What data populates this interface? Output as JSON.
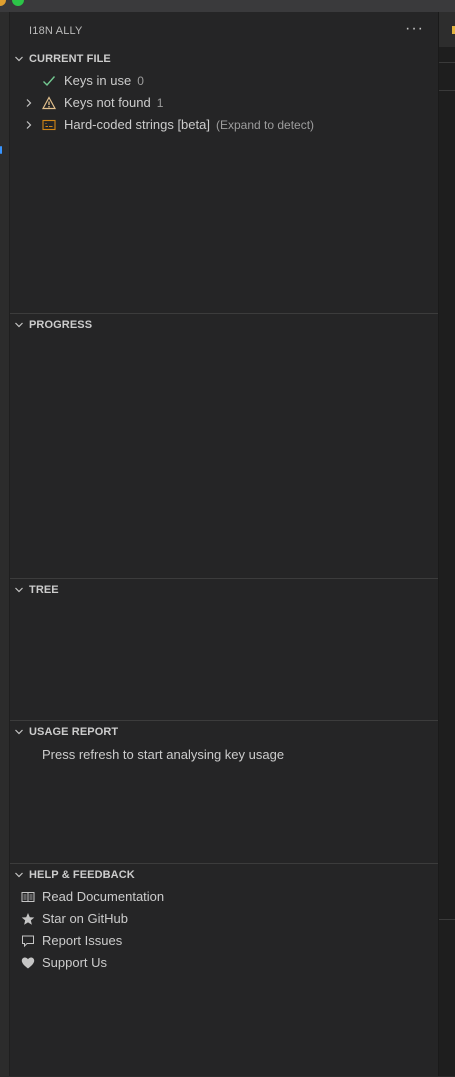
{
  "panel_title": "I18N ALLY",
  "more_actions_label": "···",
  "sections": {
    "current_file": {
      "title": "CURRENT FILE",
      "items": [
        {
          "label": "Keys in use",
          "count": "0",
          "icon": "check-icon"
        },
        {
          "label": "Keys not found",
          "count": "1",
          "icon": "warning-icon"
        },
        {
          "label": "Hard-coded strings [beta]",
          "desc": "(Expand to detect)",
          "icon": "string-icon"
        }
      ]
    },
    "progress": {
      "title": "PROGRESS"
    },
    "tree": {
      "title": "TREE"
    },
    "usage_report": {
      "title": "USAGE REPORT",
      "message": "Press refresh to start analysing key usage"
    },
    "help_feedback": {
      "title": "HELP & FEEDBACK",
      "items": [
        {
          "label": "Read Documentation",
          "icon": "book-icon"
        },
        {
          "label": "Star on GitHub",
          "icon": "star-icon"
        },
        {
          "label": "Report Issues",
          "icon": "comment-icon"
        },
        {
          "label": "Support Us",
          "icon": "heart-icon"
        }
      ]
    }
  },
  "colors": {
    "sidebar_bg": "#252526",
    "check": "#73c991",
    "warning": "#e2c08d",
    "string_icon": "#d18616",
    "text": "#cccccc",
    "muted": "#9d9d9d"
  }
}
